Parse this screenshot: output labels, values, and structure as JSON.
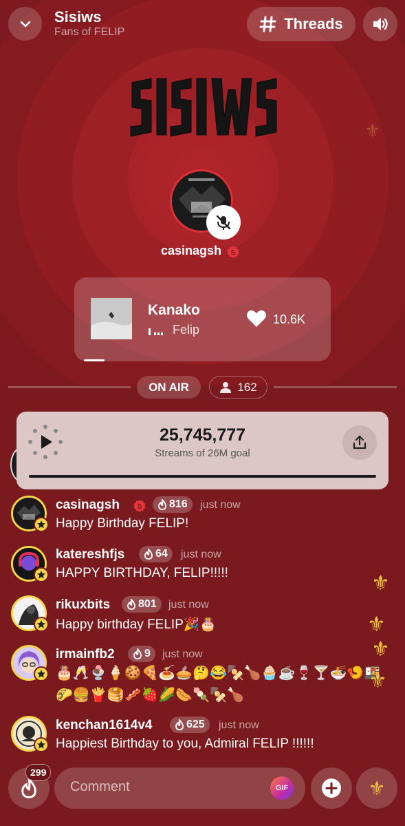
{
  "header": {
    "room_title": "Sisiws",
    "room_subtitle": "Fans of FELIP",
    "threads_label": "Threads",
    "collapse_icon": "chevron-down-icon",
    "speaker_icon": "speaker-icon"
  },
  "host": {
    "username": "casinagsh",
    "mic_state": "muted"
  },
  "now_playing": {
    "title": "Kanako",
    "artist": "Felip",
    "likes": "10.6K"
  },
  "status": {
    "on_air_label": "ON AIR",
    "viewer_count": "162"
  },
  "goal": {
    "number": "25,745,777",
    "label": "Streams of 26M goal",
    "progress": 0.99
  },
  "messages": [
    {
      "username": "casinagsh",
      "fire": "816",
      "time": "just now",
      "text": "Happy Birthday FELIP!",
      "host_badge": true
    },
    {
      "username": "katereshfjs",
      "fire": "64",
      "time": "just now",
      "text": "HAPPY BIRTHDAY, FELIP!!!!!"
    },
    {
      "username": "rikuxbits",
      "fire": "801",
      "time": "just now",
      "text": "Happy birthday FELIP🎉🎂"
    },
    {
      "username": "irmainfb2",
      "fire": "9",
      "time": "just now",
      "text_line1": "🎂🥂🍨🍦🍪🍕🍝🥧🤔😂🍢🍗🧁☕🍷🍸🍜🍤🍱",
      "text_line2": "🌮🍔🍟🥞🥓🍓🌽🌭🍡🍢🍗"
    },
    {
      "username": "kenchan1614v4",
      "fire": "625",
      "time": "just now",
      "text": "Happiest Birthday to you, Admiral FELIP !!!!!!"
    }
  ],
  "bottom": {
    "fire_count": "299",
    "comment_placeholder": "Comment",
    "gif_label": "GIF"
  },
  "colors": {
    "background": "#7a1a1e",
    "accent_gold": "#f0c040",
    "badge_yellow": "#f6d64a"
  }
}
